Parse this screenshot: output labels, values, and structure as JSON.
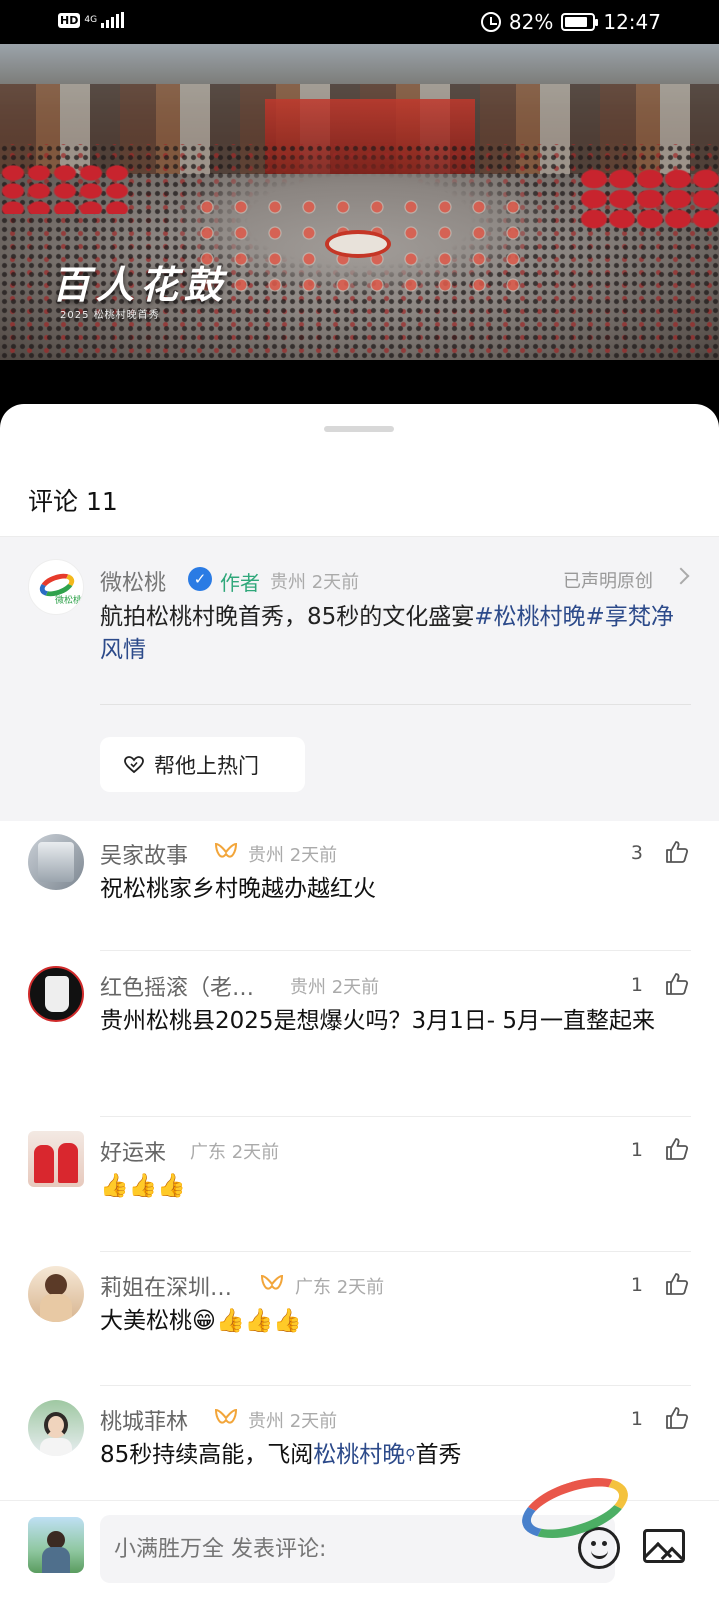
{
  "status_bar": {
    "hd": "HD",
    "network": "4G",
    "battery_text": "82%",
    "battery_level": 0.82,
    "time": "12:47"
  },
  "video": {
    "title_overlay": "百人花鼓",
    "subtitle_overlay": "2025 松桃村晚首秀"
  },
  "comments_header": {
    "label": "评论 11"
  },
  "author_post": {
    "name": "微松桃",
    "author_tag": "作者",
    "region": "贵州",
    "time": "2天前",
    "original_label": "已声明原创",
    "text_plain": "航拍松桃村晚首秀，85秒的文化盛宴",
    "hashtag": "#松桃村晚#",
    "text_tail": "享梵净风情",
    "boost_button": "帮他上热门",
    "avatar_text": "微松桃"
  },
  "comments": [
    {
      "name": "吴家故事",
      "region": "贵州",
      "time": "2天前",
      "text": "祝松桃家乡村晚越办越红火",
      "likes": "3"
    },
    {
      "name": "红色摇滚（老…",
      "region": "贵州",
      "time": "2天前",
      "text": "贵州松桃县2025是想爆火吗？3月1日- 5月一直整起来",
      "likes": "1"
    },
    {
      "name": "好运来",
      "region": "广东",
      "time": "2天前",
      "text": "👍👍👍",
      "likes": "1"
    },
    {
      "name": "莉姐在深圳…",
      "region": "广东",
      "time": "2天前",
      "text": "大美松桃😁👍👍👍",
      "likes": "1"
    },
    {
      "name": "桃城菲林",
      "region": "贵州",
      "time": "2天前",
      "text_pre": "85秒持续高能，飞阅",
      "text_link": "松桃村晚",
      "text_post": "首秀",
      "likes": "1"
    }
  ],
  "input": {
    "placeholder": "小满胜万全 发表评论:"
  },
  "colors": {
    "hashtag_blue": "#2c4a8a",
    "author_green": "#2fa77a",
    "verified_blue": "#2a7be4"
  }
}
